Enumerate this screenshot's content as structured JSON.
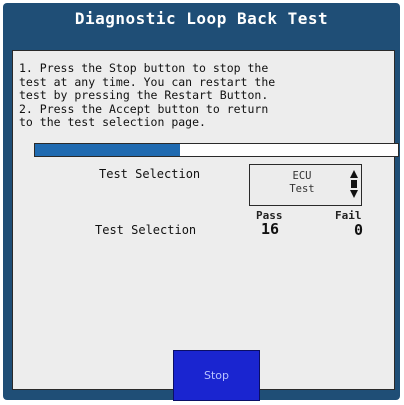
{
  "title": "Diagnostic Loop Back Test",
  "instructions": "1. Press the Stop button to stop the\ntest at any time. You can restart the\ntest by pressing the Restart Button.\n2. Press the Accept button to return\nto the test selection page.",
  "progress": {
    "fraction": 0.4
  },
  "selection_row": {
    "label": "Test Selection",
    "selected_value_line1": "ECU",
    "selected_value_line2": "Test",
    "icon": "up-down-stepper-icon"
  },
  "results_row": {
    "label": "Test Selection",
    "pass_header": "Pass",
    "fail_header": "Fail",
    "pass_value": "16",
    "fail_value": "0"
  },
  "stop_button": {
    "label": "Stop"
  },
  "colors": {
    "frame": "#1f4e76",
    "progress_fill": "#1f6ab0",
    "stop_button": "#1a25d0"
  }
}
